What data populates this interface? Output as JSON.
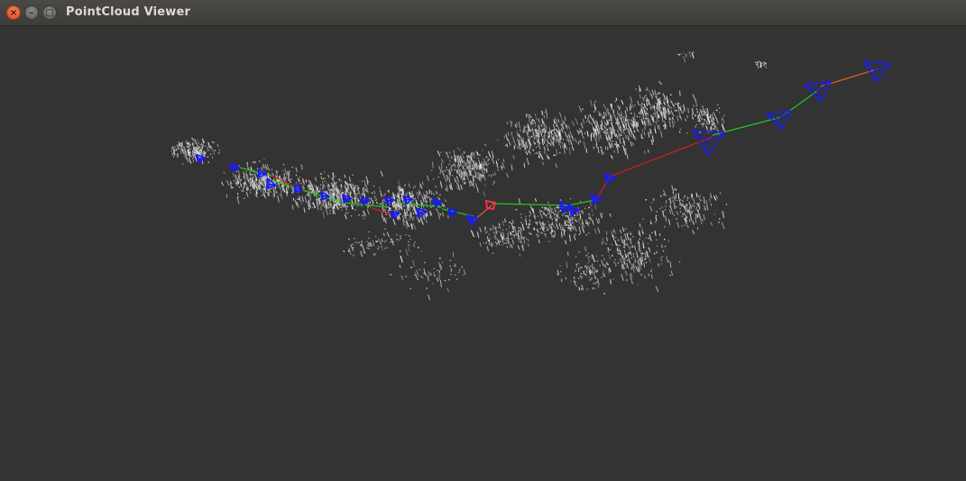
{
  "window": {
    "title": "PointCloud Viewer",
    "close_glyph": "×",
    "minimize_glyph": "–",
    "maximize_glyph": "□"
  },
  "icons": {
    "close": "close-icon",
    "minimize": "minimize-icon",
    "maximize": "maximize-icon"
  },
  "colors": {
    "background": "#333333",
    "points": "#d8d8d8",
    "keyframe": "#1a1aff",
    "trajectory_green": "#1ec81e",
    "trajectory_red": "#d21e1e",
    "trajectory_orange": "#d2641e",
    "current_camera": "#ff2850"
  }
}
